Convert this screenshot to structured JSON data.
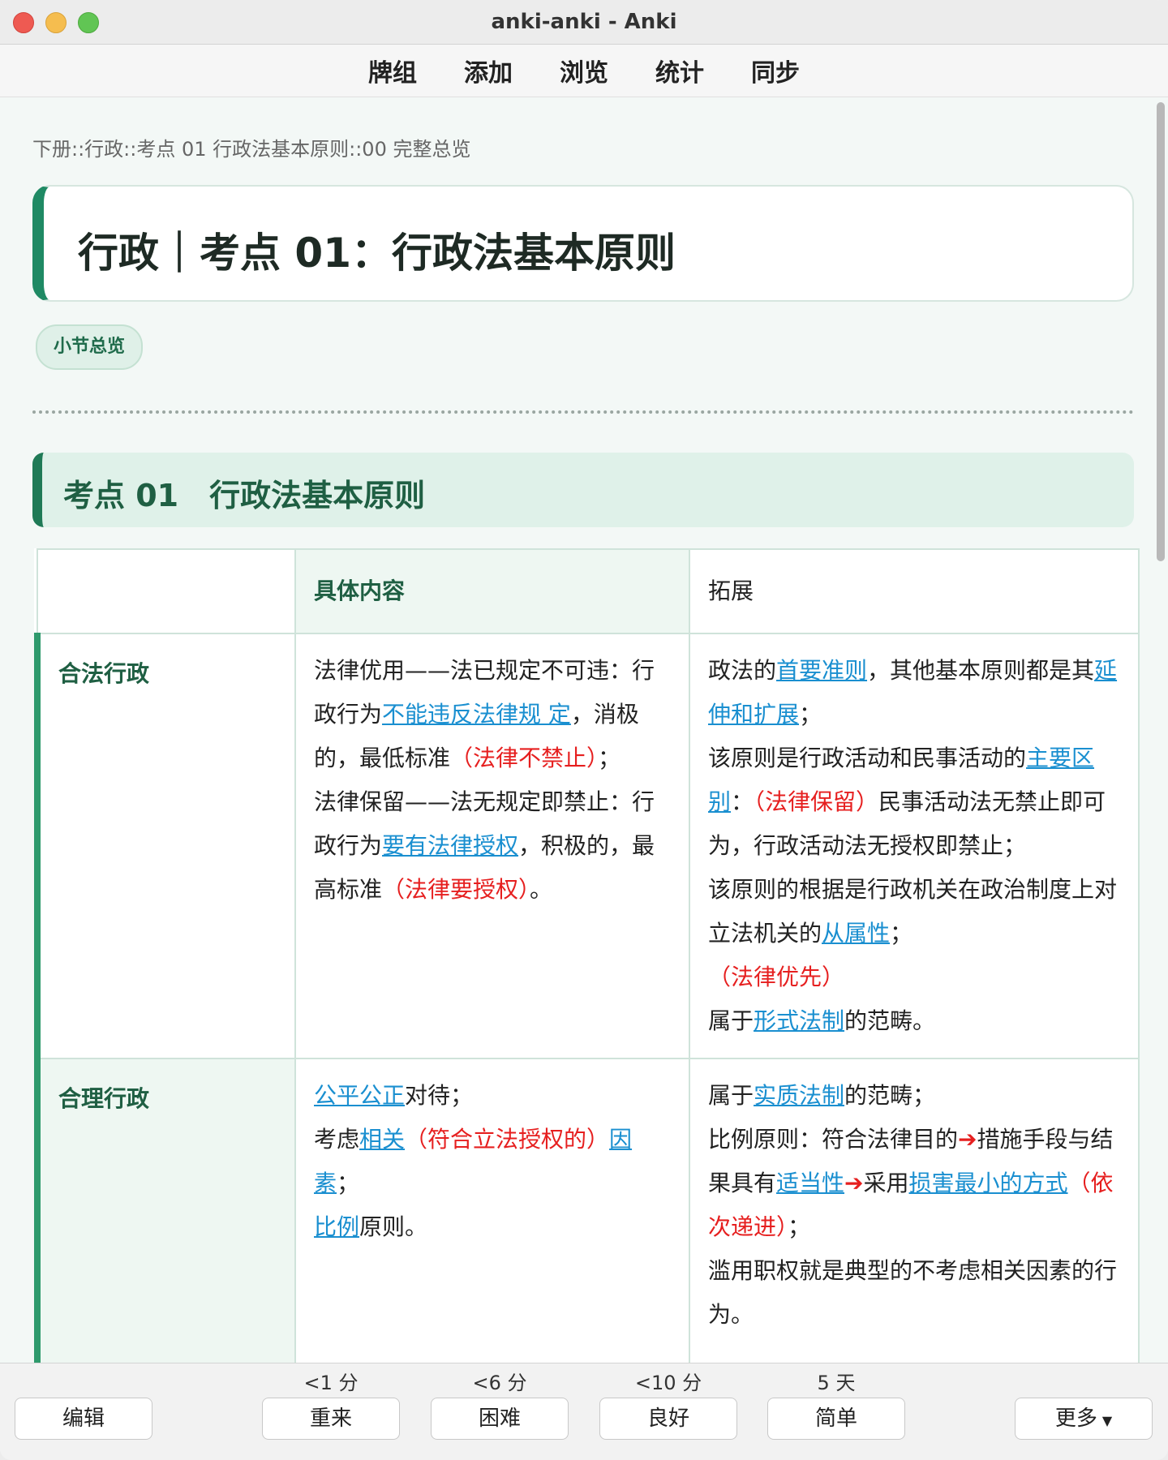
{
  "window": {
    "title": "anki-anki - Anki"
  },
  "topnav": {
    "items": [
      "牌组",
      "添加",
      "浏览",
      "统计",
      "同步"
    ]
  },
  "card": {
    "breadcrumb": "下册::行政::考点 01 行政法基本原则::00 完整总览",
    "title": "行政｜考点 01：行政法基本原则",
    "tag": "小节总览",
    "section_heading": "考点 01　行政法基本原则",
    "table": {
      "headers": [
        "",
        "具体内容",
        "拓展"
      ],
      "rows": [
        {
          "label": "合法行政",
          "main": {
            "p1": "法律优用——法已规定不可违：行政行为",
            "p1_hl": "不能违反法律规 定",
            "p1_tail": "，消极的，最低标准",
            "p1_red": "（法律不禁止）",
            "p1_end": "；",
            "p2": "法律保留——法无规定即禁止：行政行为",
            "p2_hl": "要有法律授权",
            "p2_tail": "，积极的，最高标准",
            "p2_red": "（法律要授权）",
            "p2_end": "。"
          },
          "ext": {
            "a1": "政法的",
            "a1_hl": "首要准则",
            "a1_tail": "，其他基本原则都是其",
            "a2_hl": "延伸和扩展",
            "a2_tail": "；",
            "b1": "该原则是行政活动和民事活动的",
            "b1_hl": "主要区别",
            "b1_tail": "：",
            "b1_red": "（法律保留）",
            "b1_end": "民事活动法无禁止即可为，行政活动法无授权即禁止；",
            "c1": "该原则的根据是行政机关在政治制度上对立法机关的",
            "c1_hl": "从属性",
            "c1_tail": "；",
            "d_red": "（法律优先）",
            "e1": "属于",
            "e1_hl": "形式法制",
            "e1_tail": "的范畴。"
          }
        },
        {
          "label": "合理行政",
          "main": {
            "a_hl": "公平公正",
            "a_tail": "对待；",
            "b1": "考虑",
            "b_hl": "相关",
            "b_red": "（符合立法授权的）",
            "b_hl2": "因素",
            "b_end": "；",
            "c_hl": "比例",
            "c_tail": "原则。"
          },
          "ext": {
            "a1": "属于",
            "a_hl": "实质法制",
            "a_tail": "的范畴；",
            "b1": "比例原则：符合法律目的",
            "arrow": "➔",
            "b2": "措施手段与结果具有",
            "b_hl": "适当性",
            "b3": "采用",
            "b_hl2": "损害最小的方式",
            "b_red": "（依次递进）",
            "b_end": "；",
            "c1": "滥用职权就是典型的不考虑相关因素的行为。"
          }
        }
      ]
    }
  },
  "answer_bar": {
    "edit": "编辑",
    "again": {
      "label": "重来",
      "time": "<1 分"
    },
    "hard": {
      "label": "困难",
      "time": "<6 分"
    },
    "good": {
      "label": "良好",
      "time": "<10 分"
    },
    "easy": {
      "label": "简单",
      "time": "5 天"
    },
    "more": "更多"
  }
}
